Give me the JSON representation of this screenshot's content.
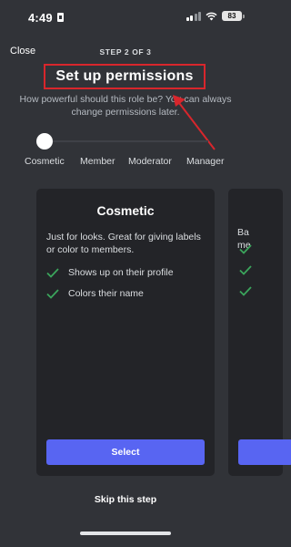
{
  "status_bar": {
    "time": "4:49",
    "battery": "83"
  },
  "header": {
    "close_label": "Close",
    "step_label": "STEP 2 OF 3",
    "title": "Set up permissions",
    "subtitle": "How powerful should this role be? You can always change permissions later."
  },
  "slider": {
    "labels": [
      "Cosmetic",
      "Member",
      "Moderator",
      "Manager"
    ],
    "selected": "Cosmetic",
    "selected_index": 0
  },
  "card": {
    "title": "Cosmetic",
    "description": "Just for looks. Great for giving labels or color to members.",
    "features": [
      "Shows up on their profile",
      "Colors their name"
    ],
    "select_label": "Select"
  },
  "next_card": {
    "text_line_1": "Ba",
    "text_line_2": "me"
  },
  "footer": {
    "skip_label": "Skip this step"
  },
  "colors": {
    "background": "#313338",
    "card": "#232428",
    "accent": "#5865f2",
    "check": "#3ba55c",
    "annotation": "#d8262c"
  }
}
